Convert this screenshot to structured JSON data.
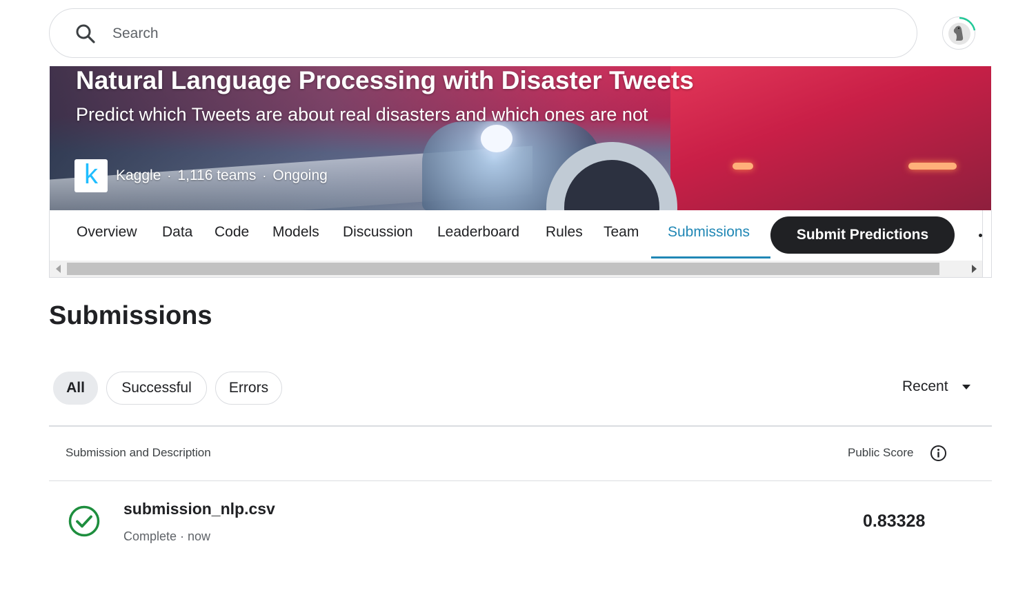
{
  "search": {
    "placeholder": "Search"
  },
  "hero": {
    "title": "Natural Language Processing with Disaster Tweets",
    "subtitle": "Predict which Tweets are about real disasters and which ones are not",
    "host": "Kaggle",
    "teams": "1,116 teams",
    "status": "Ongoing",
    "separator": "·",
    "logo_letter": "k"
  },
  "tabs": [
    {
      "label": "Overview"
    },
    {
      "label": "Data"
    },
    {
      "label": "Code"
    },
    {
      "label": "Models"
    },
    {
      "label": "Discussion"
    },
    {
      "label": "Leaderboard"
    },
    {
      "label": "Rules"
    },
    {
      "label": "Team"
    },
    {
      "label": "Submissions"
    }
  ],
  "active_tab": "Submissions",
  "submit_button": "Submit Predictions",
  "page": {
    "title": "Submissions"
  },
  "filters": {
    "all": "All",
    "successful": "Successful",
    "errors": "Errors",
    "sort": "Recent"
  },
  "table": {
    "col_submission": "Submission and Description",
    "col_score": "Public Score",
    "rows": [
      {
        "file": "submission_nlp.csv",
        "status": "Complete · now",
        "score": "0.83328"
      }
    ]
  },
  "colors": {
    "accent": "#2087b5",
    "success": "#1e8e3e",
    "button_dark": "#202124",
    "kaggle_blue": "#20beff"
  }
}
